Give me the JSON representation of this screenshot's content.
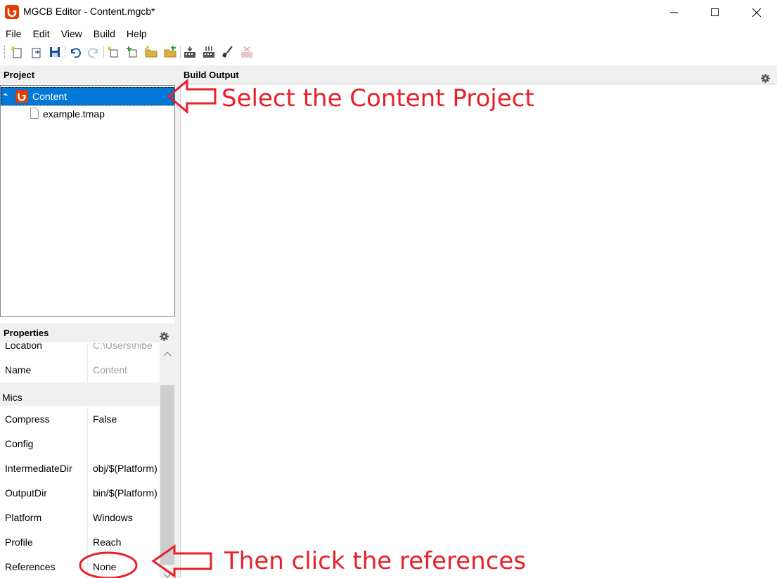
{
  "window": {
    "title": "MGCB Editor - Content.mgcb*",
    "controls": [
      "minimize",
      "maximize",
      "close"
    ]
  },
  "menu": {
    "items": [
      "File",
      "Edit",
      "View",
      "Build",
      "Help"
    ]
  },
  "toolbar": {
    "icons": [
      "new-icon",
      "open-icon",
      "save-icon",
      "undo-icon",
      "redo-icon",
      "new-item-icon",
      "add-existing-item-icon",
      "new-folder-icon",
      "add-existing-folder-icon",
      "build-icon",
      "rebuild-icon",
      "clean-icon",
      "cancel-build-icon"
    ]
  },
  "project": {
    "header": "Project",
    "tree": [
      {
        "label": "Content",
        "icon": "monogame-icon",
        "selected": true
      },
      {
        "label": "example.tmap",
        "icon": "file-icon",
        "selected": false
      }
    ]
  },
  "build_output": {
    "header": "Build Output"
  },
  "properties": {
    "header": "Properties",
    "rows_top": [
      {
        "name": "Location",
        "value": "C:\\Users\\hibe"
      },
      {
        "name": "Name",
        "value": "Content"
      }
    ],
    "category": "Mics",
    "rows": [
      {
        "name": "Compress",
        "value": "False"
      },
      {
        "name": "Config",
        "value": ""
      },
      {
        "name": "IntermediateDir",
        "value": "obj/$(Platform)"
      },
      {
        "name": "OutputDir",
        "value": "bin/$(Platform)"
      },
      {
        "name": "Platform",
        "value": "Windows"
      },
      {
        "name": "Profile",
        "value": "Reach"
      },
      {
        "name": "References",
        "value": "None"
      }
    ]
  },
  "annotations": {
    "select_project": "Select the Content Project",
    "click_references": "Then click the references",
    "color": "#e8202a"
  },
  "colors": {
    "selection": "#0078d7",
    "monogame": "#e73c00"
  }
}
